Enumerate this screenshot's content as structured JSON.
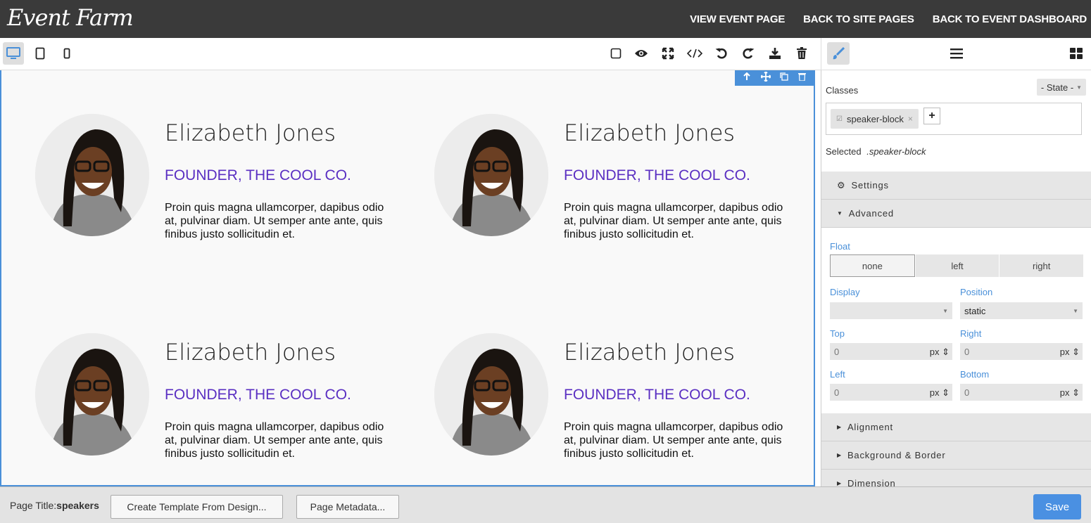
{
  "app": {
    "logo": "Event Farm"
  },
  "topnav": {
    "view_event": "VIEW EVENT PAGE",
    "back_site": "BACK TO SITE PAGES",
    "back_dashboard": "BACK TO EVENT DASHBOARD"
  },
  "devices": [
    "desktop-icon",
    "tablet-icon",
    "mobile-icon"
  ],
  "tools": [
    "square-outline-icon",
    "eye-icon",
    "fullscreen-icon",
    "code-icon",
    "undo-icon",
    "redo-icon",
    "download-icon",
    "trash-icon"
  ],
  "panel_tabs": [
    "brush-icon",
    "menu-icon",
    "blocks-icon"
  ],
  "speakers": [
    {
      "name": "Elizabeth Jones",
      "title": "FOUNDER, THE COOL CO.",
      "bio": "Proin quis magna ullamcorper, dapibus odio at, pulvinar diam. Ut semper ante ante, quis finibus justo sollicitudin et."
    },
    {
      "name": "Elizabeth Jones",
      "title": "FOUNDER, THE COOL CO.",
      "bio": "Proin quis magna ullamcorper, dapibus odio at, pulvinar diam. Ut semper ante ante, quis finibus justo sollicitudin et."
    },
    {
      "name": "Elizabeth Jones",
      "title": "FOUNDER, THE COOL CO.",
      "bio": "Proin quis magna ullamcorper, dapibus odio at, pulvinar diam. Ut semper ante ante, quis finibus justo sollicitudin et."
    },
    {
      "name": "Elizabeth Jones",
      "title": "FOUNDER, THE COOL CO.",
      "bio": "Proin quis magna ullamcorper, dapibus odio at, pulvinar diam. Ut semper ante ante, quis finibus justo sollicitudin et."
    }
  ],
  "panel": {
    "classes_label": "Classes",
    "state": "- State -",
    "tag": "speaker-block",
    "selected_label": "Selected",
    "selected_value": ".speaker-block",
    "settings": "Settings",
    "advanced": "Advanced",
    "float_label": "Float",
    "float_options": [
      "none",
      "left",
      "right"
    ],
    "float_selected": "none",
    "display_label": "Display",
    "display_value": "",
    "position_label": "Position",
    "position_value": "static",
    "top_label": "Top",
    "top_value": "0",
    "right_label": "Right",
    "right_value": "0",
    "left_label": "Left",
    "left_value": "0",
    "bottom_label": "Bottom",
    "bottom_value": "0",
    "unit": "px",
    "alignment": "Alignment",
    "background": "Background & Border",
    "dimension": "Dimension"
  },
  "bottom": {
    "page_title_label": "Page Title:",
    "page_title_value": "speakers",
    "create_template": "Create Template From Design...",
    "metadata": "Page Metadata...",
    "save": "Save"
  },
  "colors": {
    "accent": "#4a90d9",
    "title_purple": "#5a2fc2",
    "topbar": "#3a3a3a"
  }
}
